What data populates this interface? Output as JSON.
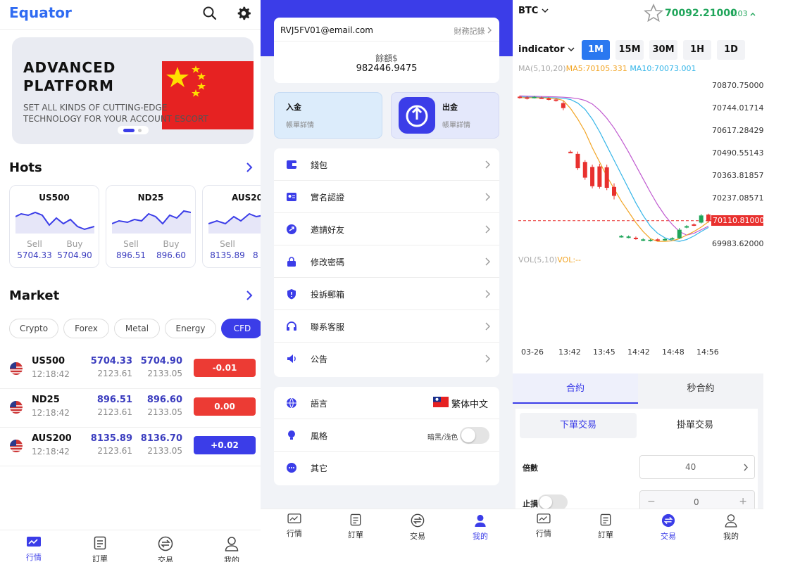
{
  "colors": {
    "accent": "#3b3de8",
    "brand": "#2f6bf2",
    "up": "#1fa55a",
    "down": "#e8302e",
    "watermark": "#f05a10"
  },
  "home": {
    "brand": "Equator",
    "icons": [
      "search-icon",
      "gear-icon"
    ],
    "banner": {
      "title1": "ADVANCED",
      "title2": "PLATFORM",
      "line1": "SET ALL KINDS OF CUTTING-EDGE",
      "line2": "TECHNOLOGY FOR YOUR ACCOUNT ESCORT"
    },
    "hots_title": "Hots",
    "hots": [
      {
        "name": "US500",
        "sell_label": "Sell",
        "buy_label": "Buy",
        "sell": "5704.33",
        "buy": "5704.90"
      },
      {
        "name": "ND25",
        "sell_label": "Sell",
        "buy_label": "Buy",
        "sell": "896.51",
        "buy": "896.60"
      },
      {
        "name": "AUS200",
        "sell_label": "Sell",
        "buy_label": "Buy",
        "sell": "8135.89",
        "buy": "8"
      }
    ],
    "market_title": "Market",
    "chips": [
      "Crypto",
      "Forex",
      "Metal",
      "Energy",
      "CFD"
    ],
    "rows": [
      {
        "name": "US500",
        "time": "12:18:42",
        "v1": "5704.33",
        "v2": "5704.90",
        "s1": "2123.61",
        "s2": "2133.05",
        "change": "-0.01",
        "change_color": "#e8302e"
      },
      {
        "name": "ND25",
        "time": "12:18:42",
        "v1": "896.51",
        "v2": "896.60",
        "s1": "2123.61",
        "s2": "2133.05",
        "change": "0.00",
        "change_color": "#e8302e"
      },
      {
        "name": "AUS200",
        "time": "12:18:42",
        "v1": "8135.89",
        "v2": "8136.70",
        "s1": "2123.61",
        "s2": "2133.05",
        "change": "+0.02",
        "change_color": "#3b3de8"
      }
    ],
    "tabs": [
      "行情",
      "訂單",
      "交易",
      "我的"
    ]
  },
  "profile": {
    "email": "RVJ5FV01@email.com",
    "records_link": "財務記錄",
    "balance_label": "餘額$",
    "balance": "982446.9475",
    "deposit": {
      "title": "入金",
      "sub": "帳單詳情"
    },
    "withdraw": {
      "title": "出金",
      "sub": "帳單詳情"
    },
    "menu": [
      "錢包",
      "實名認證",
      "邀請好友",
      "修改密碼",
      "投訴郵箱",
      "聯系客服",
      "公告"
    ],
    "language_label": "語言",
    "language_value": "繁体中文",
    "style_label": "風格",
    "style_value": "暗黑/浅色",
    "other_label": "其它",
    "tabs": [
      "行情",
      "訂單",
      "交易",
      "我的"
    ]
  },
  "trade": {
    "symbol": "BTC",
    "price": "70092.21000",
    "change": "-1.03",
    "indicator": "indicator",
    "timeframes": [
      "1M",
      "15M",
      "30M",
      "1H",
      "1D"
    ],
    "ma_label": "MA(5,10,20)",
    "ma5": "MA5:70105.331",
    "ma10": "MA10:70073.001",
    "y_ticks": [
      "70870.75000",
      "70744.01714",
      "70617.28429",
      "70490.55143",
      "70363.81857",
      "70237.08571",
      "70110.81000",
      "69983.62000"
    ],
    "x_ticks": [
      "03-26",
      "13:42",
      "13:45",
      "14:42",
      "14:48",
      "14:56"
    ],
    "vol_label": "VOL(5,10)",
    "vol_value": "VOL:--",
    "mode_tabs": [
      "合約",
      "秒合約"
    ],
    "order_tabs": [
      "下單交易",
      "掛單交易"
    ],
    "multiplier_label": "倍數",
    "multiplier_value": "40",
    "stoploss_label": "止損",
    "stepper_value": "0",
    "tabs": [
      "行情",
      "訂單",
      "交易",
      "我的"
    ]
  },
  "chart_data": {
    "type": "candlestick",
    "symbol": "BTC",
    "ylim": [
      69983.62,
      70870.75
    ],
    "current_price": 70110.81,
    "x_ticks": [
      "03-26",
      "13:42",
      "13:45",
      "14:42",
      "14:48",
      "14:56"
    ],
    "candles": [
      {
        "o": 70806,
        "c": 70800,
        "h": 70812,
        "l": 70795
      },
      {
        "o": 70802,
        "c": 70797,
        "h": 70808,
        "l": 70790
      },
      {
        "o": 70800,
        "c": 70805,
        "h": 70810,
        "l": 70796
      },
      {
        "o": 70801,
        "c": 70798,
        "h": 70806,
        "l": 70794
      },
      {
        "o": 70796,
        "c": 70790,
        "h": 70803,
        "l": 70785
      },
      {
        "o": 70790,
        "c": 70784,
        "h": 70797,
        "l": 70778
      },
      {
        "o": 70770,
        "c": 70742,
        "h": 70780,
        "l": 70730
      },
      {
        "o": 70497,
        "c": 70495,
        "h": 70505,
        "l": 70490
      },
      {
        "o": 70485,
        "c": 70405,
        "h": 70498,
        "l": 70395
      },
      {
        "o": 70440,
        "c": 70352,
        "h": 70450,
        "l": 70340
      },
      {
        "o": 70412,
        "c": 70304,
        "h": 70425,
        "l": 70292
      },
      {
        "o": 70415,
        "c": 70300,
        "h": 70430,
        "l": 70290
      },
      {
        "o": 70410,
        "c": 70295,
        "h": 70425,
        "l": 70282
      },
      {
        "o": 70300,
        "c": 70250,
        "h": 70320,
        "l": 70230
      },
      {
        "o": 70022,
        "c": 70025,
        "h": 70030,
        "l": 70016
      },
      {
        "o": 70018,
        "c": 70022,
        "h": 70028,
        "l": 70012
      },
      {
        "o": 70015,
        "c": 70010,
        "h": 70022,
        "l": 70004
      },
      {
        "o": 70002,
        "c": 70006,
        "h": 70012,
        "l": 69996
      },
      {
        "o": 70000,
        "c": 70004,
        "h": 70008,
        "l": 69994
      },
      {
        "o": 70006,
        "c": 70002,
        "h": 70012,
        "l": 69996
      },
      {
        "o": 70005,
        "c": 70008,
        "h": 70014,
        "l": 69998
      },
      {
        "o": 70010,
        "c": 70013,
        "h": 70018,
        "l": 70004
      },
      {
        "o": 70012,
        "c": 70060,
        "h": 70070,
        "l": 70008
      },
      {
        "o": 70075,
        "c": 70080,
        "h": 70086,
        "l": 70068
      },
      {
        "o": 70090,
        "c": 70085,
        "h": 70096,
        "l": 70080
      },
      {
        "o": 70100,
        "c": 70140,
        "h": 70148,
        "l": 70095
      },
      {
        "o": 70145,
        "c": 70108,
        "h": 70150,
        "l": 70100
      }
    ],
    "ma5": [
      70800,
      70800,
      70800,
      70799,
      70798,
      70795,
      70785,
      70740,
      70680,
      70610,
      70520,
      70440,
      70360,
      70290,
      70220,
      70160,
      70100,
      70050,
      70010,
      69995,
      69995,
      69998,
      70010,
      70030,
      70050,
      70075,
      70105
    ],
    "ma10": [
      70805,
      70804,
      70803,
      70802,
      70801,
      70799,
      70797,
      70790,
      70770,
      70735,
      70680,
      70610,
      70530,
      70450,
      70370,
      70290,
      70210,
      70140,
      70080,
      70040,
      70015,
      70000,
      69995,
      70005,
      70025,
      70050,
      70073
    ],
    "ma20": [
      70810,
      70809,
      70808,
      70807,
      70806,
      70805,
      70803,
      70800,
      70795,
      70785,
      70765,
      70730,
      70685,
      70630,
      70565,
      70495,
      70420,
      70345,
      70270,
      70200,
      70140,
      70090,
      70050,
      70030,
      70040,
      70060,
      70080
    ]
  }
}
